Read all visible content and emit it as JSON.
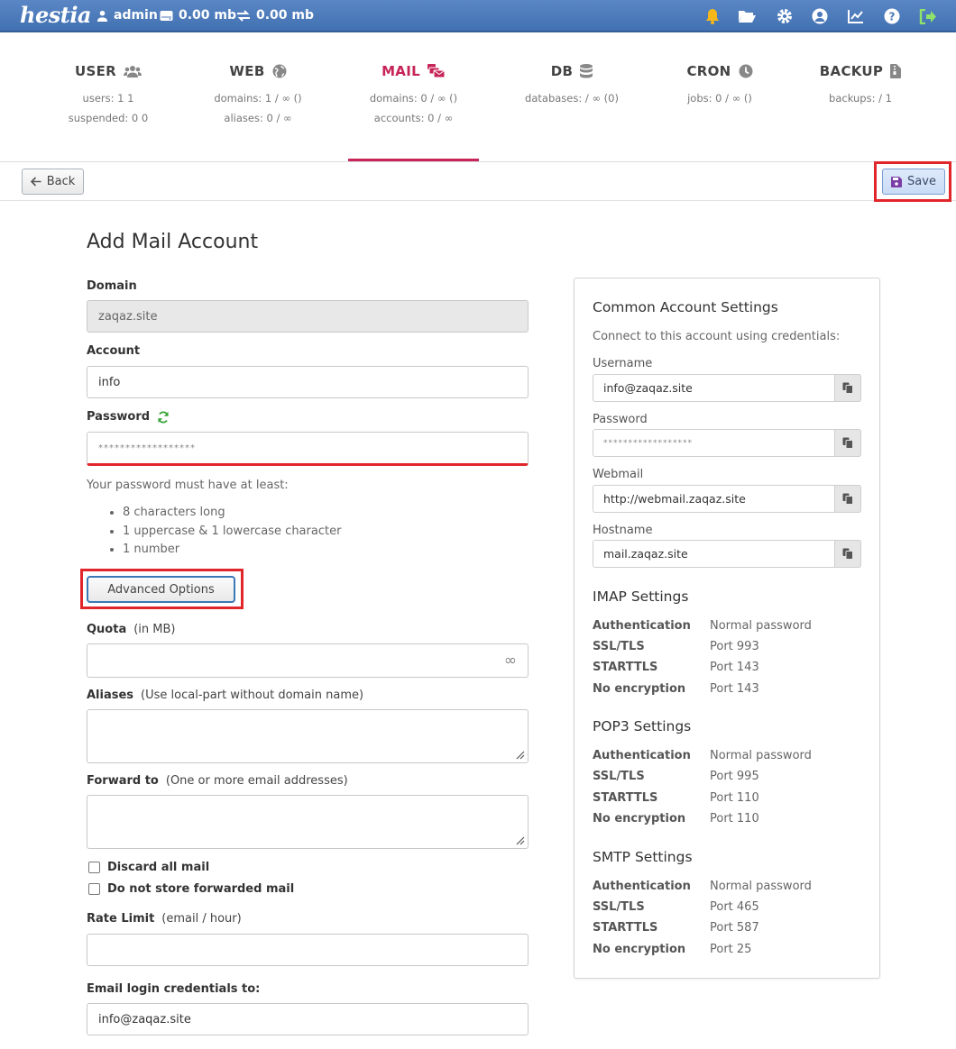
{
  "topbar": {
    "logo": "hestia",
    "user": "admin",
    "disk": "0.00 mb",
    "bandwidth": "0.00 mb"
  },
  "tabs": [
    {
      "label": "USER",
      "line1": "users: 1 1",
      "line2": "suspended: 0 0",
      "icon": "users-icon"
    },
    {
      "label": "WEB",
      "line1": "domains: 1 / ∞ ()",
      "line2": "aliases: 0 / ∞",
      "icon": "globe-icon"
    },
    {
      "label": "MAIL",
      "line1": "domains: 0 / ∞ ()",
      "line2": "accounts: 0 / ∞",
      "icon": "mail-bulk-icon"
    },
    {
      "label": "DB",
      "line1": "databases: / ∞ (0)",
      "line2": "",
      "icon": "database-icon"
    },
    {
      "label": "CRON",
      "line1": "jobs: 0 / ∞ ()",
      "line2": "",
      "icon": "clock-icon"
    },
    {
      "label": "BACKUP",
      "line1": "backups: / 1",
      "line2": "",
      "icon": "file-archive-icon"
    }
  ],
  "toolbar": {
    "back_label": "Back",
    "save_label": "Save"
  },
  "form": {
    "title": "Add Mail Account",
    "domain_label": "Domain",
    "domain_value": "zaqaz.site",
    "account_label": "Account",
    "account_value": "info",
    "password_label": "Password",
    "password_value": "******************",
    "password_note": "Your password must have at least:",
    "password_rules": [
      "8 characters long",
      "1 uppercase & 1 lowercase character",
      "1 number"
    ],
    "advanced_label": "Advanced Options",
    "quota_label": "Quota",
    "quota_hint": "(in MB)",
    "quota_symbol": "∞",
    "aliases_label": "Aliases",
    "aliases_hint": "(Use local-part without domain name)",
    "forward_label": "Forward to",
    "forward_hint": "(One or more email addresses)",
    "discard_label": "Discard all mail",
    "nostore_label": "Do not store forwarded mail",
    "rate_label": "Rate Limit",
    "rate_hint": "(email / hour)",
    "send_label": "Email login credentials to:",
    "send_value": "info@zaqaz.site"
  },
  "panel": {
    "title": "Common Account Settings",
    "subtitle": "Connect to this account using credentials:",
    "fields": [
      {
        "label": "Username",
        "value": "info@zaqaz.site"
      },
      {
        "label": "Password",
        "value": "******************"
      },
      {
        "label": "Webmail",
        "value": "http://webmail.zaqaz.site"
      },
      {
        "label": "Hostname",
        "value": "mail.zaqaz.site"
      }
    ],
    "sections": [
      {
        "title": "IMAP Settings",
        "rows": [
          {
            "k": "Authentication",
            "v": "Normal password"
          },
          {
            "k": "SSL/TLS",
            "v": "Port 993"
          },
          {
            "k": "STARTTLS",
            "v": "Port 143"
          },
          {
            "k": "No encryption",
            "v": "Port 143"
          }
        ]
      },
      {
        "title": "POP3 Settings",
        "rows": [
          {
            "k": "Authentication",
            "v": "Normal password"
          },
          {
            "k": "SSL/TLS",
            "v": "Port 995"
          },
          {
            "k": "STARTTLS",
            "v": "Port 110"
          },
          {
            "k": "No encryption",
            "v": "Port 110"
          }
        ]
      },
      {
        "title": "SMTP Settings",
        "rows": [
          {
            "k": "Authentication",
            "v": "Normal password"
          },
          {
            "k": "SSL/TLS",
            "v": "Port 465"
          },
          {
            "k": "STARTTLS",
            "v": "Port 587"
          },
          {
            "k": "No encryption",
            "v": "Port 25"
          }
        ]
      }
    ]
  },
  "colors": {
    "accent": "#c72458",
    "topbar": "#4a78b8",
    "highlight": "#e0262b"
  }
}
